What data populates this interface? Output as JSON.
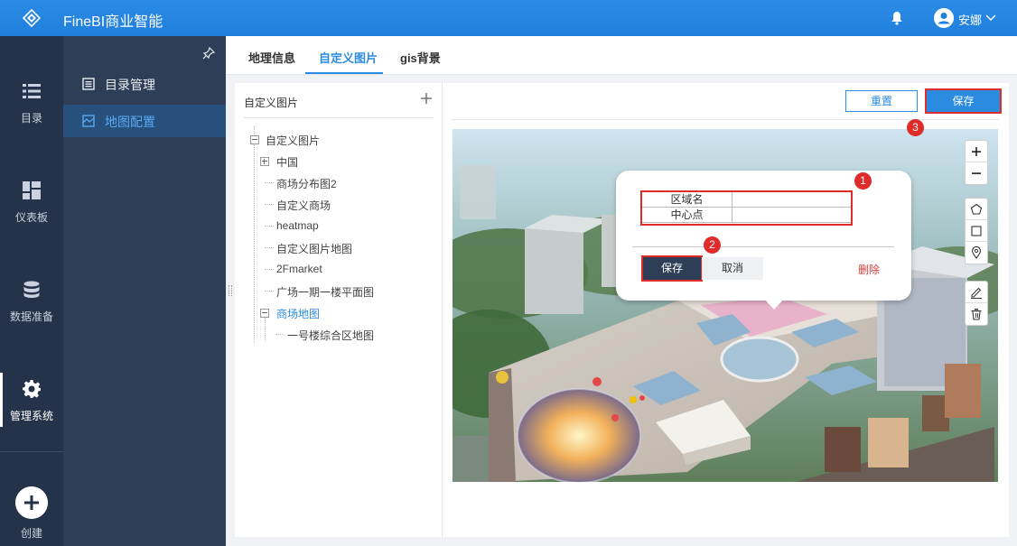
{
  "app": {
    "title": "FineBI商业智能"
  },
  "user": {
    "name": "安娜"
  },
  "nav": {
    "items": [
      {
        "label": "目录"
      },
      {
        "label": "仪表板"
      },
      {
        "label": "数据准备"
      },
      {
        "label": "管理系统"
      }
    ],
    "create_label": "创建"
  },
  "submenu": {
    "items": [
      {
        "label": "目录管理"
      },
      {
        "label": "地图配置"
      }
    ]
  },
  "tabs": [
    {
      "label": "地理信息"
    },
    {
      "label": "自定义图片"
    },
    {
      "label": "gis背景"
    }
  ],
  "tree": {
    "header": "自定义图片",
    "nodes": [
      {
        "label": "自定义图片"
      },
      {
        "label": "中国"
      },
      {
        "label": "商场分布图2"
      },
      {
        "label": "自定义商场"
      },
      {
        "label": "heatmap"
      },
      {
        "label": "自定义图片地图"
      },
      {
        "label": "2Fmarket"
      },
      {
        "label": "广场一期一楼平面图"
      },
      {
        "label": "商场地图"
      },
      {
        "label": "一号楼综合区地图"
      }
    ]
  },
  "toolbar": {
    "reset_label": "重置",
    "save_label": "保存"
  },
  "popup": {
    "fields": [
      {
        "label": "区域名"
      },
      {
        "label": "中心点"
      }
    ],
    "save_label": "保存",
    "cancel_label": "取消",
    "delete_label": "删除"
  },
  "badges": [
    "1",
    "2",
    "3"
  ],
  "colors": {
    "accent": "#2a8be0",
    "topbar": "#1f7fdc",
    "sidebar": "#243349",
    "highlight": "#e02b2b"
  },
  "map_tools": [
    "zoom-in-icon",
    "zoom-out-icon",
    "polygon-icon",
    "rectangle-icon",
    "marker-icon",
    "edit-icon",
    "trash-icon"
  ]
}
